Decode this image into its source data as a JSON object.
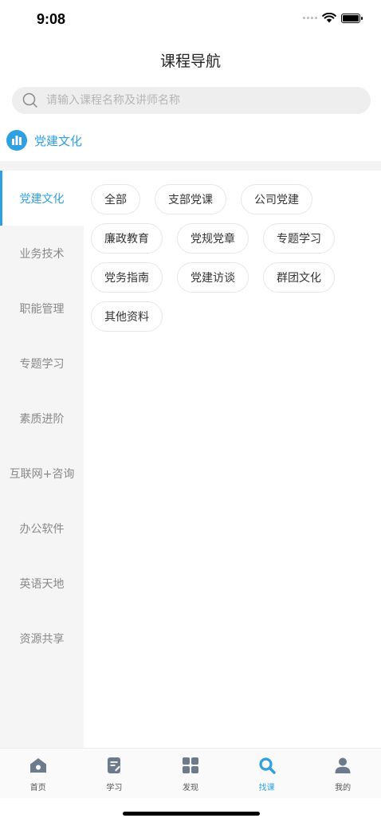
{
  "status_bar": {
    "time": "9:08"
  },
  "nav": {
    "title": "课程导航"
  },
  "search": {
    "placeholder": "请输入课程名称及讲师名称"
  },
  "section": {
    "icon": "building-icon",
    "title": "党建文化"
  },
  "sidebar": {
    "items": [
      {
        "label": "党建文化",
        "active": true
      },
      {
        "label": "业务技术"
      },
      {
        "label": "职能管理"
      },
      {
        "label": "专题学习"
      },
      {
        "label": "素质进阶"
      },
      {
        "label": "互联网+咨询"
      },
      {
        "label": "办公软件"
      },
      {
        "label": "英语天地"
      },
      {
        "label": "资源共享"
      }
    ]
  },
  "tags": [
    "全部",
    "支部党课",
    "公司党建",
    "廉政教育",
    "党规党章",
    "专题学习",
    "党务指南",
    "党建访谈",
    "群团文化",
    "其他资料"
  ],
  "tab_bar": {
    "items": [
      {
        "label": "首页",
        "icon": "home-icon"
      },
      {
        "label": "学习",
        "icon": "notepad-icon"
      },
      {
        "label": "发现",
        "icon": "grid-icon"
      },
      {
        "label": "找课",
        "icon": "search-icon",
        "active": true
      },
      {
        "label": "我的",
        "icon": "user-icon"
      }
    ]
  },
  "colors": {
    "accent": "#2fa0e0",
    "icon_gray": "#6b7a8c"
  }
}
